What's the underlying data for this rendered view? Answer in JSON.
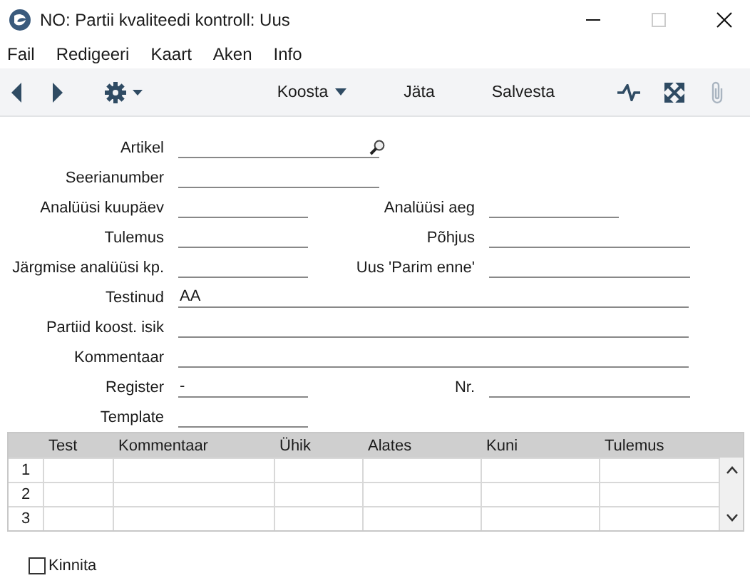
{
  "window": {
    "title": "NO: Partii kvaliteedi kontroll: Uus"
  },
  "menu": [
    "Fail",
    "Redigeeri",
    "Kaart",
    "Aken",
    "Info"
  ],
  "toolbar": {
    "buttons": [
      {
        "label": "Koosta",
        "kind": "dropdown"
      },
      {
        "label": "Jäta",
        "kind": "plain"
      },
      {
        "label": "Salvesta",
        "kind": "plain"
      }
    ]
  },
  "form": [
    {
      "label": "Artikel",
      "kind": "lookup"
    },
    {
      "label": "Seerianumber",
      "kind": "long"
    },
    {
      "label": "Analüüsi kuupäev",
      "kind": "short",
      "right": {
        "label": "Analüüsi aeg",
        "kind": "short"
      }
    },
    {
      "label": "Tulemus",
      "kind": "short",
      "right": {
        "label": "Põhjus",
        "kind": "long"
      }
    },
    {
      "label": "Järgmise analüüsi kp.",
      "kind": "short",
      "right": {
        "label": "Uus 'Parim enne'",
        "kind": "long"
      }
    },
    {
      "label": "Testinud",
      "value": "AA",
      "kind": "full"
    },
    {
      "label": "Partiid koost. isik",
      "kind": "full"
    },
    {
      "label": "Kommentaar",
      "kind": "full"
    },
    {
      "label": "Register",
      "value": "-",
      "kind": "short",
      "right": {
        "label": "Nr.",
        "kind": "long"
      }
    },
    {
      "label": "Template",
      "kind": "short"
    }
  ],
  "table": {
    "columns": [
      "Test",
      "Kommentaar",
      "Ühik",
      "Alates",
      "Kuni",
      "Tulemus"
    ],
    "rows": [
      {
        "number": "1"
      },
      {
        "number": "2"
      },
      {
        "number": "3"
      }
    ]
  },
  "confirm": {
    "label": "Kinnita",
    "checked": false
  }
}
